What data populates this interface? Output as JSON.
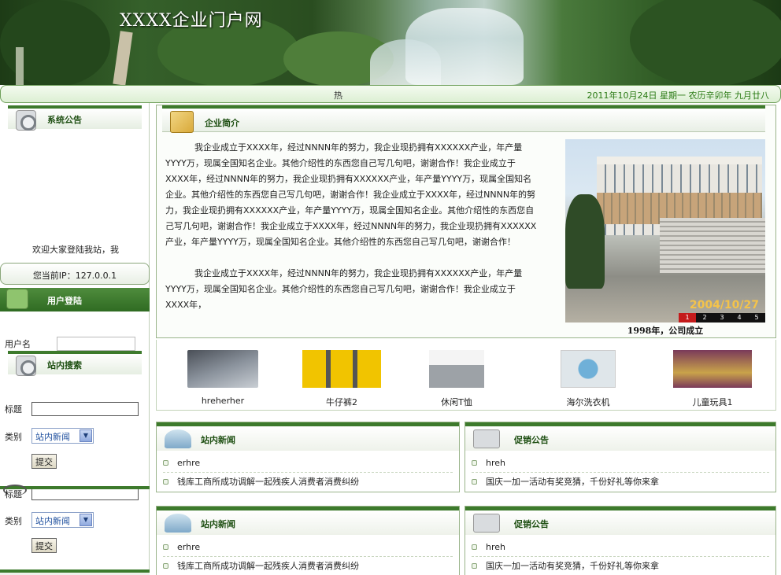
{
  "banner": {
    "site_title": "XXXX企业门户网"
  },
  "status_bar": {
    "hot_label": "热",
    "date_line": "2011年10月24日 星期一 农历辛卯年 九月廿八"
  },
  "sidebar": {
    "announcement": {
      "title": "系统公告",
      "ticker": "欢迎大家登陆我站，我"
    },
    "ip_line": "您当前IP：127.0.0.1",
    "login": {
      "title": "用户登陆",
      "username_label": "用户名"
    },
    "search": {
      "title": "站内搜索",
      "title_label": "标题",
      "category_label": "类别",
      "category_value": "站内新闻",
      "submit_label": "提交"
    },
    "search2": {
      "title_label": "标题",
      "category_label": "类别",
      "category_value": "站内新闻",
      "submit_label": "提交"
    }
  },
  "intro": {
    "title": "企业简介",
    "paragraphs": [
      "我企业成立于XXXX年，经过NNNN年的努力，我企业现扔拥有XXXXXX产业，年产量YYYY万，现属全国知名企业。其他介绍性的东西您自己写几句吧，谢谢合作！我企业成立于XXXX年，经过NNNN年的努力，我企业现扔拥有XXXXXX产业，年产量YYYY万，现属全国知名企业。其他介绍性的东西您自己写几句吧，谢谢合作！我企业成立于XXXX年，经过NNNN年的努力，我企业现扔拥有XXXXXX产业，年产量YYYY万，现属全国知名企业。其他介绍性的东西您自己写几句吧，谢谢合作！我企业成立于XXXX年，经过NNNN年的努力，我企业现扔拥有XXXXXX产业，年产量YYYY万，现属全国知名企业。其他介绍性的东西您自己写几句吧，谢谢合作！",
      "我企业成立于XXXX年，经过NNNN年的努力，我企业现扔拥有XXXXXX产业，年产量YYYY万，现属全国知名企业。其他介绍性的东西您自己写几句吧，谢谢合作！我企业成立于XXXX年，"
    ],
    "photo_date": "2004/10/27",
    "slide_numbers": [
      "1",
      "2",
      "3",
      "4",
      "5"
    ],
    "caption": "1998年，公司成立"
  },
  "products": [
    {
      "name": "hreherher",
      "icon": "laptop-image"
    },
    {
      "name": "牛仔裤2",
      "icon": "jacket-image"
    },
    {
      "name": "休闲T恤",
      "icon": "tshirt-image"
    },
    {
      "name": "海尔洗衣机",
      "icon": "washer-image"
    },
    {
      "name": "儿童玩具1",
      "icon": "toy-image"
    }
  ],
  "news_panels": [
    {
      "title": "站内新闻",
      "items": [
        "erhre",
        "钱库工商所成功调解一起残疾人消费者消费纠纷"
      ]
    },
    {
      "title": "促销公告",
      "items": [
        "hreh",
        "国庆一加一活动有奖竞猜，千份好礼等你来拿"
      ]
    },
    {
      "title": "站内新闻",
      "items": [
        "erhre",
        "钱库工商所成功调解一起残疾人消费者消费纠纷"
      ]
    },
    {
      "title": "促销公告",
      "items": [
        "hreh",
        "国庆一加一活动有奖竞猜，千份好礼等你来拿"
      ]
    }
  ]
}
